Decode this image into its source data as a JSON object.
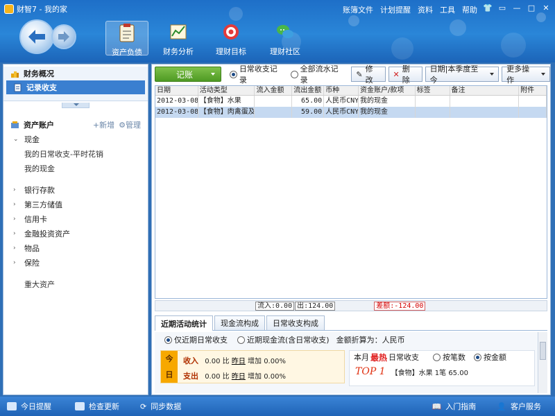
{
  "app": {
    "title": "财智7 - 我的家"
  },
  "top_menu": [
    "账簿文件",
    "计划提醒",
    "资料",
    "工具",
    "帮助"
  ],
  "main_tabs": [
    "资产负债",
    "财务分析",
    "理财目标",
    "理财社区"
  ],
  "sidebar": {
    "top_items": [
      "财务概况",
      "记录收支"
    ],
    "asset_header": "资产账户",
    "asset_actions": {
      "add": "+新增",
      "manage": "管理"
    },
    "cash": {
      "label": "现金",
      "children": [
        "我的日常收支-平时花销",
        "我的现金"
      ]
    },
    "groups": [
      "银行存款",
      "第三方储值",
      "信用卡",
      "金融投资资产",
      "物品",
      "保险"
    ],
    "extra": "重大资产"
  },
  "toolbar": {
    "record_label": "记账",
    "radio_daily": "日常收支记录",
    "radio_all": "全部流水记录",
    "edit_label": "修改",
    "delete_label": "删除",
    "date_filter": "日期|本季度至今",
    "more_label": "更多操作"
  },
  "grid": {
    "columns": [
      "日期",
      "活动类型",
      "流入金额",
      "流出金额",
      "币种",
      "资金账户/款项",
      "标签",
      "备注",
      "附件"
    ],
    "rows": [
      {
        "date": "2012-03-08",
        "type": "【食物】水果",
        "in": "",
        "out": "65.00",
        "cur": "人民币CNY",
        "acc": "我的现金",
        "tag": "",
        "note": "",
        "att": ""
      },
      {
        "date": "2012-03-08",
        "type": "【食物】肉禽蛋及",
        "in": "",
        "out": "59.00",
        "cur": "人民币CNY",
        "acc": "我的现金",
        "tag": "",
        "note": "",
        "att": ""
      }
    ]
  },
  "totals": {
    "in": "流入:0.00",
    "out": "出:124.00",
    "diff": "差额:-124.00"
  },
  "lower_tabs": [
    "近期活动统计",
    "现金流构成",
    "日常收支构成"
  ],
  "lower": {
    "radio_recent_daily": "仅近期日常收支",
    "radio_recent_cash": "近期现金流(含日常收支)",
    "conversion": "金额折算为：人民币",
    "today_label": [
      "今",
      "日"
    ],
    "income_line": {
      "label": "收入",
      "value": "0.00",
      "cmp": "比",
      "yesterday": "昨日",
      "change": "增加 0.00%"
    },
    "expense_line": {
      "label": "支出",
      "value": "0.00",
      "cmp": "比",
      "yesterday": "昨日",
      "change": "增加 0.00%"
    },
    "hot_prefix": "本月",
    "hot_word": "最热",
    "hot_suffix": "日常收支",
    "hot_radio_count": "按笔数",
    "hot_radio_amount": "按金额",
    "top1_label": "TOP 1",
    "top1_item": "【食物】水果 1笔 65.00"
  },
  "statusbar": {
    "reminder": "今日提醒",
    "update": "检查更新",
    "sync": "同步数据",
    "guide": "入门指南",
    "service": "客户服务"
  }
}
